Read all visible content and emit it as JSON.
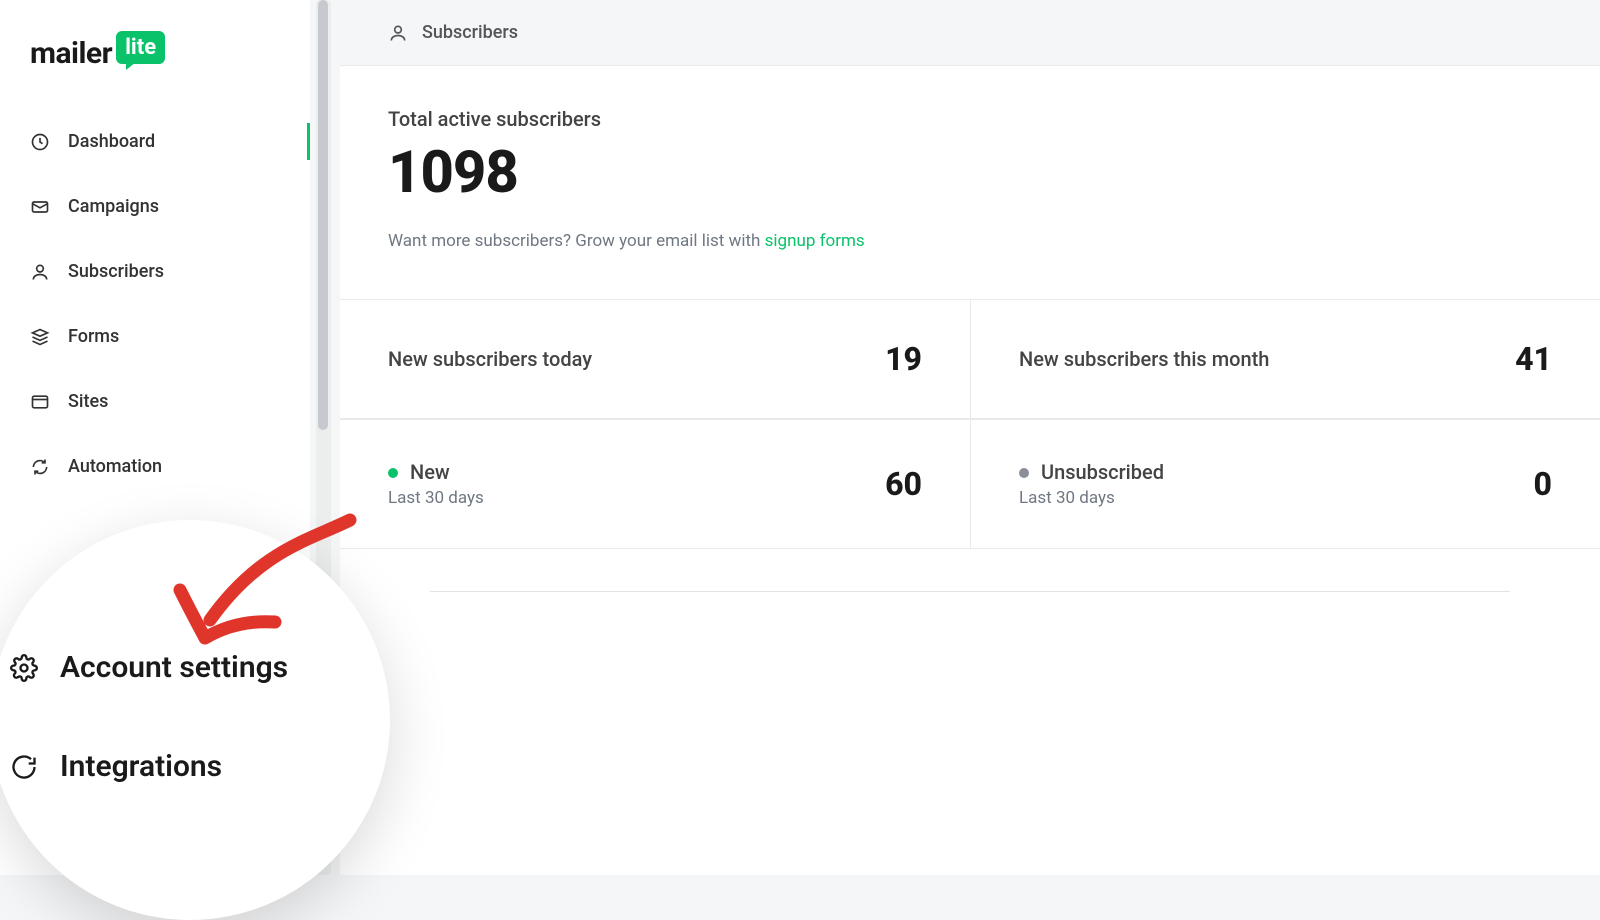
{
  "brand": {
    "left": "mailer",
    "right": "lite"
  },
  "sidebar": {
    "items": [
      {
        "label": "Dashboard",
        "icon": "clock-icon",
        "active": true
      },
      {
        "label": "Campaigns",
        "icon": "mail-icon",
        "active": false
      },
      {
        "label": "Subscribers",
        "icon": "user-icon",
        "active": false
      },
      {
        "label": "Forms",
        "icon": "layers-icon",
        "active": false
      },
      {
        "label": "Sites",
        "icon": "browser-icon",
        "active": false
      },
      {
        "label": "Automation",
        "icon": "refresh-icon",
        "active": false
      }
    ]
  },
  "breadcrumb": {
    "label": "Subscribers",
    "icon": "user-icon"
  },
  "hero": {
    "label": "Total active subscribers",
    "value": "1098",
    "hint_prefix": "Want more subscribers? ",
    "hint_mid": "Grow your email list with ",
    "hint_link": "signup forms"
  },
  "stats": {
    "today": {
      "label": "New subscribers today",
      "value": "19"
    },
    "month": {
      "label": "New subscribers this month",
      "value": "41"
    },
    "new30": {
      "label": "New",
      "sub": "Last 30 days",
      "value": "60"
    },
    "unsub30": {
      "label": "Unsubscribed",
      "sub": "Last 30 days",
      "value": "0"
    }
  },
  "magnifier": {
    "item1": "Account settings",
    "item2": "Integrations"
  },
  "colors": {
    "accent": "#09c269",
    "border": "#e8e9eb",
    "muted": "#6f7782",
    "dot_grey": "#8a8f98"
  }
}
